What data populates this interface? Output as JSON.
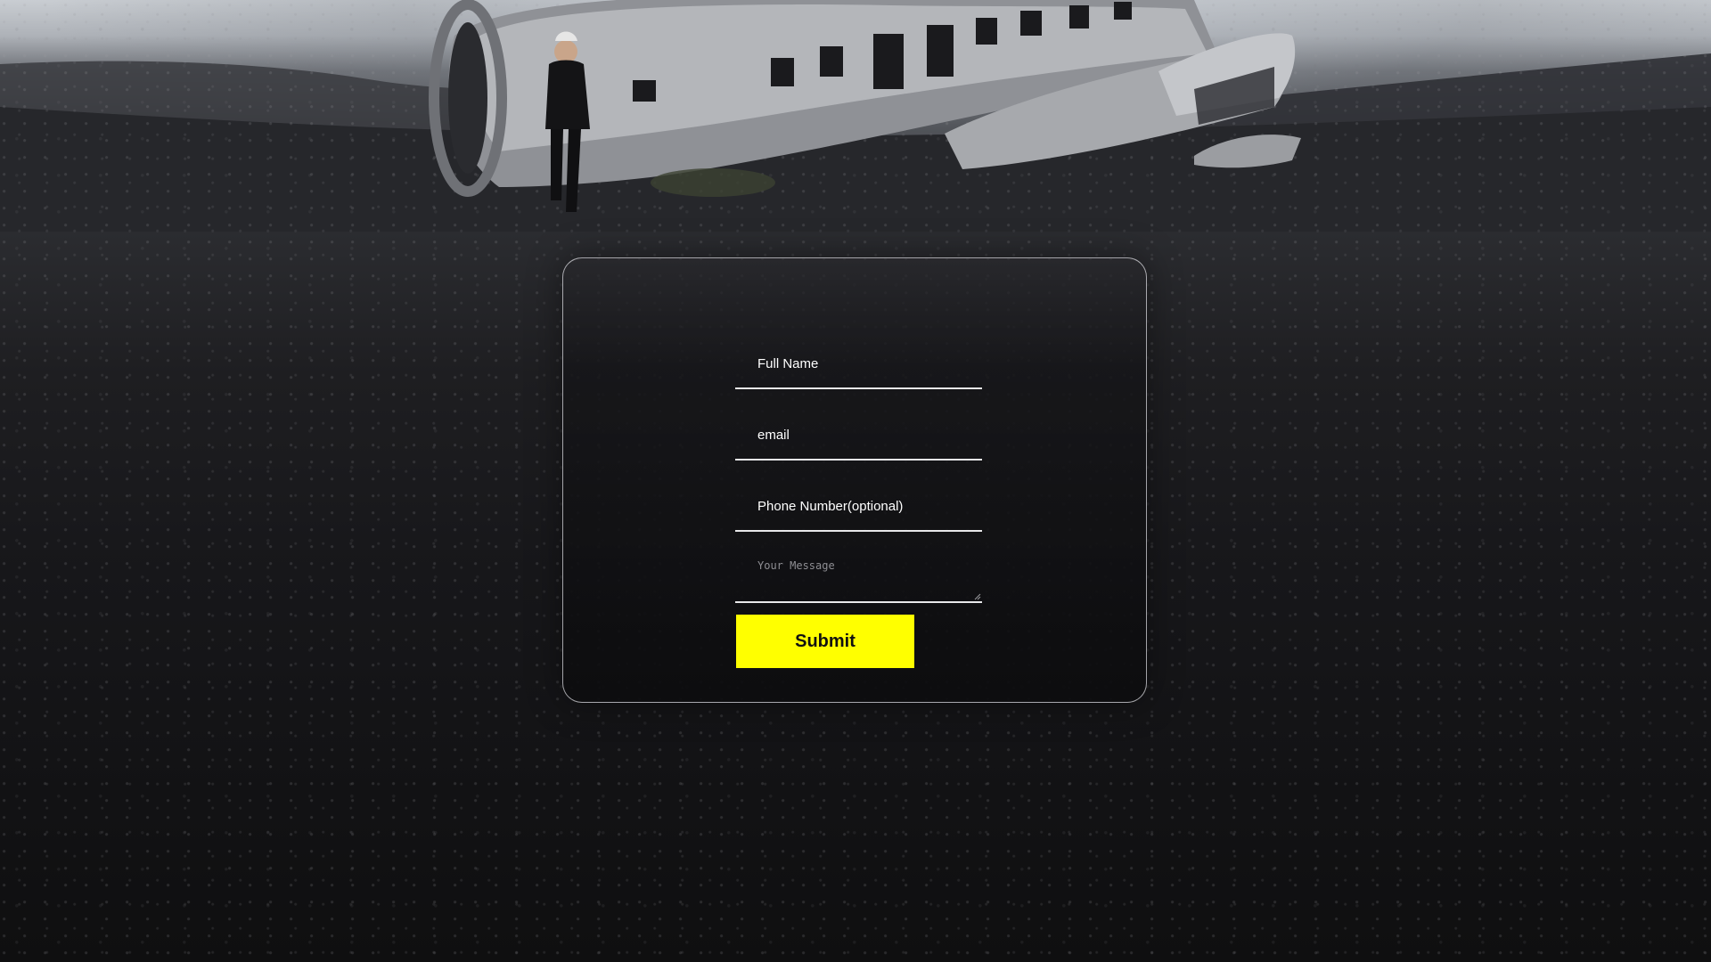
{
  "form": {
    "full_name_label": "Full Name",
    "email_label": "email",
    "phone_label": "Phone Number(optional)",
    "message_placeholder": "Your Message",
    "submit_label": "Submit"
  },
  "colors": {
    "accent": "#ffff00",
    "field_underline": "#e8e8ea",
    "card_border": "#d7d7dc"
  }
}
